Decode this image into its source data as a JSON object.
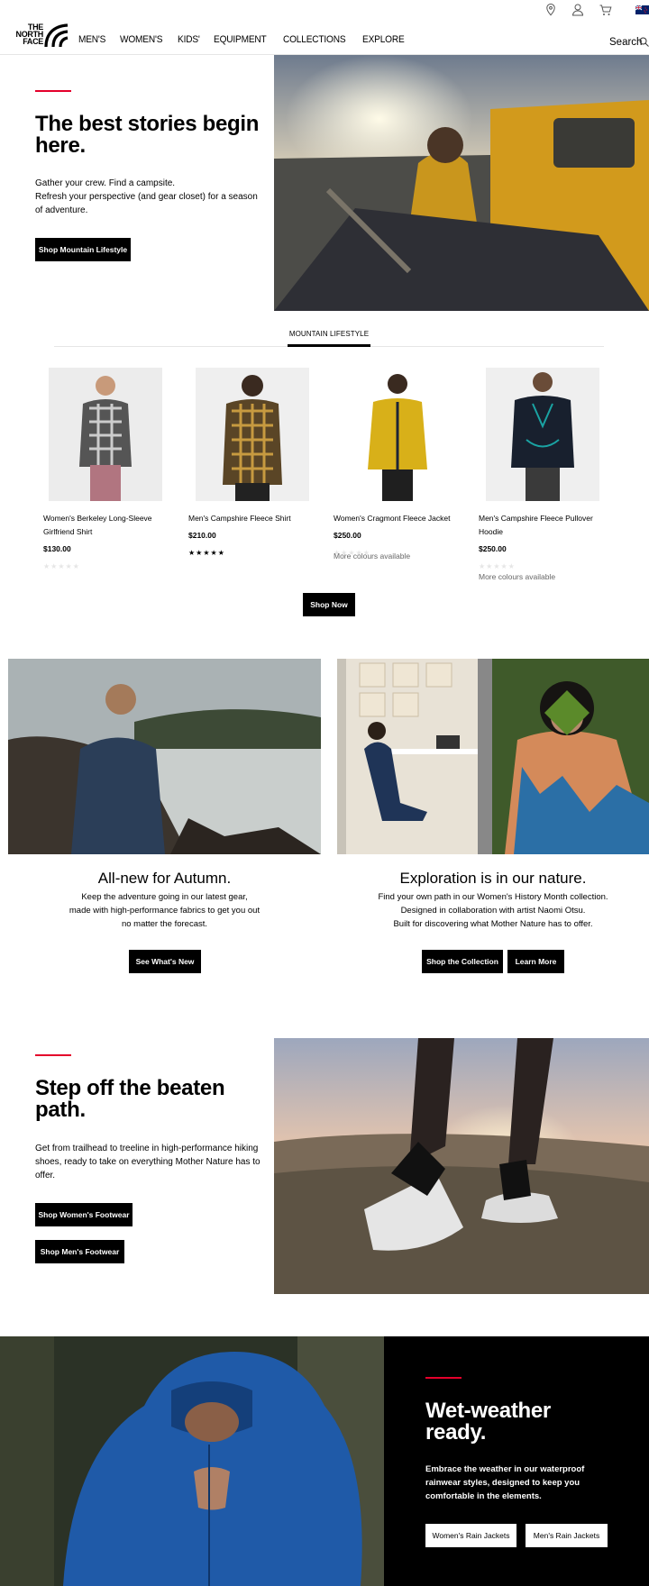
{
  "header": {
    "logo": {
      "line1": "THE",
      "line2": "NORTH",
      "line3": "FACE"
    },
    "icons": [
      "location-pin-icon",
      "user-icon",
      "cart-icon",
      "nz-flag-icon"
    ],
    "nav": [
      "MEN'S",
      "WOMEN'S",
      "KIDS'",
      "EQUIPMENT",
      "COLLECTIONS",
      "EXPLORE"
    ],
    "search_label": "Search"
  },
  "hero": {
    "title": "The best stories begin here.",
    "body_line1": "Gather your crew. Find a campsite.",
    "body_line2": "Refresh your perspective (and gear closet) for a season of adventure.",
    "button": "Shop Mountain Lifestyle"
  },
  "products": {
    "tab": "MOUNTAIN LIFESTYLE",
    "items": [
      {
        "name": "Women's Berkeley Long-Sleeve Girlfriend Shirt",
        "price": "$130.00",
        "rating": 0,
        "more_colors": ""
      },
      {
        "name": "Men's Campshire Fleece Shirt",
        "price": "$210.00",
        "rating": 5,
        "more_colors": ""
      },
      {
        "name": "Women's Cragmont Fleece Jacket",
        "price": "$250.00",
        "rating": 0,
        "more_colors": "More colours available"
      },
      {
        "name": "Men's Campshire Fleece Pullover Hoodie",
        "price": "$250.00",
        "rating": 0,
        "more_colors": "More colours available"
      }
    ],
    "button": "Shop Now"
  },
  "promo_left": {
    "title": "All-new for Autumn.",
    "line1": "Keep the adventure going in our latest gear,",
    "line2": "made with high-performance fabrics to get you out",
    "line3": "no matter the forecast.",
    "button": "See What's New"
  },
  "promo_right": {
    "title": "Exploration is in our nature.",
    "line1": "Find your own path in our Women's History Month collection.",
    "line2": "Designed in collaboration with artist Naomi Otsu.",
    "line3": "Built for discovering what Mother Nature has to offer.",
    "button1": "Shop the Collection",
    "button2": "Learn More"
  },
  "footwear": {
    "title": "Step off the beaten path.",
    "body": "Get from trailhead to treeline in high-performance hiking shoes, ready to take on everything Mother Nature has to offer.",
    "button1": "Shop Women's Footwear",
    "button2": "Shop Men's Footwear"
  },
  "rain": {
    "title": "Wet-weather ready.",
    "body": "Embrace the weather in our waterproof rainwear styles, designed to keep you comfortable in the elements.",
    "button1": "Women's Rain Jackets",
    "button2": "Men's Rain Jackets"
  },
  "colors": {
    "accent_red": "#e4002b",
    "black": "#000000"
  }
}
